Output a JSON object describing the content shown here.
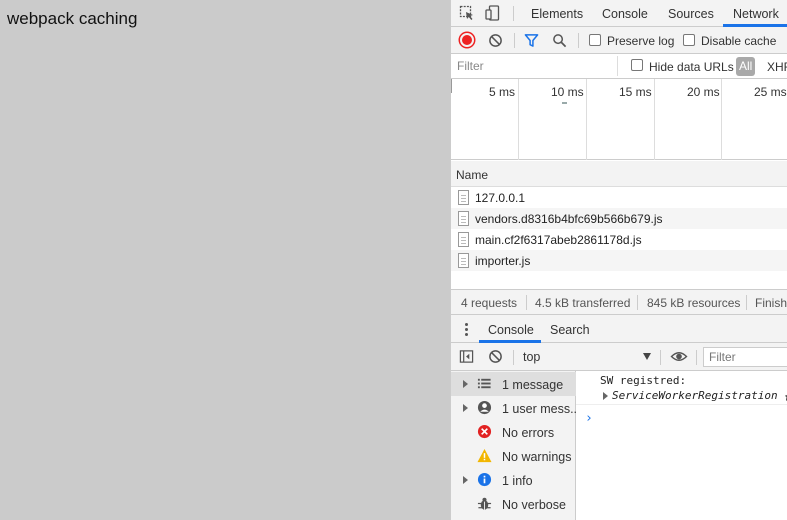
{
  "page": {
    "title": "webpack caching"
  },
  "devtools": {
    "tabs": [
      {
        "label": "Elements",
        "active": false
      },
      {
        "label": "Console",
        "active": false
      },
      {
        "label": "Sources",
        "active": false
      },
      {
        "label": "Network",
        "active": true
      }
    ],
    "network": {
      "toolbar": {
        "preserve_log": "Preserve log",
        "preserve_log_checked": false,
        "disable_cache": "Disable cache",
        "disable_cache_checked": false
      },
      "filter": {
        "placeholder": "Filter",
        "hide_data_urls": "Hide data URLs",
        "all": "All",
        "xhr": "XHR"
      },
      "timeline": {
        "ticks": [
          "5 ms",
          "10 ms",
          "15 ms",
          "20 ms",
          "25 ms"
        ]
      },
      "column_header": "Name",
      "requests": [
        {
          "name": "127.0.0.1"
        },
        {
          "name": "vendors.d8316b4bfc69b566b679.js"
        },
        {
          "name": "main.cf2f6317abeb2861178d.js"
        },
        {
          "name": "importer.js"
        }
      ],
      "status": {
        "requests": "4 requests",
        "transferred": "4.5 kB transferred",
        "resources": "845 kB resources",
        "finish": "Finish:"
      }
    },
    "drawer": {
      "tabs": [
        {
          "label": "Console",
          "active": true
        },
        {
          "label": "Search",
          "active": false
        }
      ],
      "context": "top",
      "filter_placeholder": "Filter",
      "sidebar": [
        {
          "label": "1 message",
          "icon": "list-icon",
          "expandable": true,
          "selected": true
        },
        {
          "label": "1 user mess...",
          "icon": "user-icon",
          "expandable": true,
          "selected": false
        },
        {
          "label": "No errors",
          "icon": "error-icon",
          "expandable": false,
          "selected": false
        },
        {
          "label": "No warnings",
          "icon": "warning-icon",
          "expandable": false,
          "selected": false
        },
        {
          "label": "1 info",
          "icon": "info-icon",
          "expandable": true,
          "selected": false
        },
        {
          "label": "No verbose",
          "icon": "bug-icon",
          "expandable": false,
          "selected": false
        }
      ],
      "messages": [
        {
          "text": "SW registred:",
          "object": "ServiceWorkerRegistration {"
        }
      ],
      "prompt": "›"
    },
    "colors": {
      "accent": "#1a73e8",
      "record": "#e22222",
      "error": "#e22222",
      "warning": "#f2b600",
      "info": "#1a73e8"
    }
  }
}
